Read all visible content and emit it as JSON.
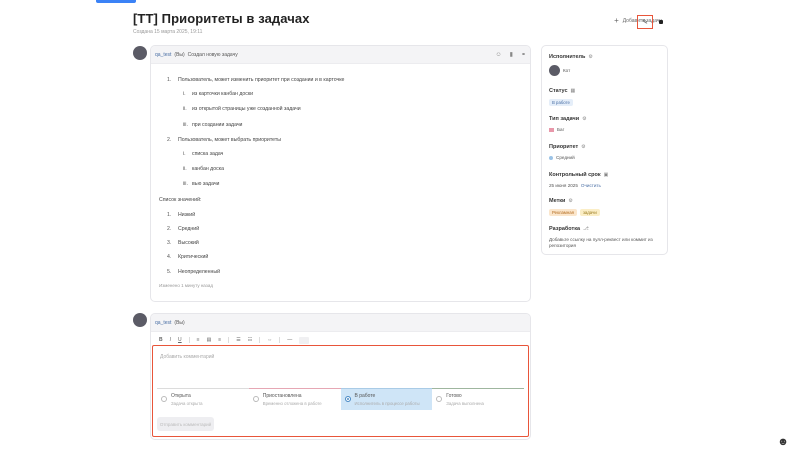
{
  "header": {
    "title": "[TT] Приоритеты в задачах",
    "subtitle": "Создана 15 марта 2025, 19:11",
    "add_task_label": "Добавить задачу",
    "edit_icon": "pencil-icon",
    "more_icon": "more-icon"
  },
  "main_card": {
    "author": "qa_test",
    "role": "(Вы)",
    "action": "Создал новую задачу",
    "footnote": "Изменено 1 минуту назад",
    "content": [
      {
        "type": "l1",
        "num": "1.",
        "text": "Пользователь, может изменить приоритет при создании и в карточке"
      },
      {
        "type": "l2",
        "num": "i.",
        "text": "из карточки канбан доски"
      },
      {
        "type": "l2",
        "num": "ii.",
        "text": "из открытой страницы уже созданной задачи"
      },
      {
        "type": "l2",
        "num": "iii.",
        "text": "при создании задачи"
      },
      {
        "type": "l1",
        "num": "2.",
        "text": "Пользователь, может выбрать приоритеты"
      },
      {
        "type": "l2",
        "num": "i.",
        "text": "списка задач"
      },
      {
        "type": "l2",
        "num": "ii.",
        "text": "канбан доска"
      },
      {
        "type": "l2",
        "num": "iii.",
        "text": "вью задачи"
      },
      {
        "type": "plain",
        "num": "",
        "text": "Список значений:"
      },
      {
        "type": "l1",
        "num": "1.",
        "text": "Низкий"
      },
      {
        "type": "l1",
        "num": "2.",
        "text": "Средний"
      },
      {
        "type": "l1",
        "num": "3.",
        "text": "Высокий"
      },
      {
        "type": "l1",
        "num": "4.",
        "text": "Критический"
      },
      {
        "type": "l1",
        "num": "5.",
        "text": "Неопределенный"
      }
    ]
  },
  "comment": {
    "author": "qa_test",
    "role": "(Вы)",
    "placeholder": "Добавить комментарий",
    "toolbar": [
      "B",
      "I",
      "U",
      "≡",
      "▤",
      "≡",
      "☰",
      "☷",
      "⇔",
      "—"
    ],
    "statuses": [
      {
        "name": "Открыта",
        "desc": "Задача открыта"
      },
      {
        "name": "Приостановлена",
        "desc": "Временно отложена в работе"
      },
      {
        "name": "В работе",
        "desc": "Исполнитель в процессе работы"
      },
      {
        "name": "Готово",
        "desc": "Задача выполнена"
      }
    ],
    "submit_label": "Отправить комментарий"
  },
  "sidebar": {
    "assignee_label": "Исполнитель",
    "assignee_value": "Кот",
    "status_label": "Статус",
    "status_value": "В работе",
    "type_label": "Тип задачи",
    "type_value": "Баг",
    "priority_label": "Приоритет",
    "priority_value": "Средний",
    "deadline_label": "Контрольный срок",
    "deadline_value": "25 июня 2025",
    "deadline_clear": "Очистить",
    "tags_label": "Метки",
    "tags": [
      "Рекламная",
      "задачи"
    ],
    "dev_label": "Разработка",
    "dev_text": "Добавьте ссылку на пулл-реквест или коммит из репозитория"
  },
  "colors": {
    "highlight": "#e8553a",
    "link": "#4a6fa5",
    "in_progress": "#cfe5f7"
  }
}
